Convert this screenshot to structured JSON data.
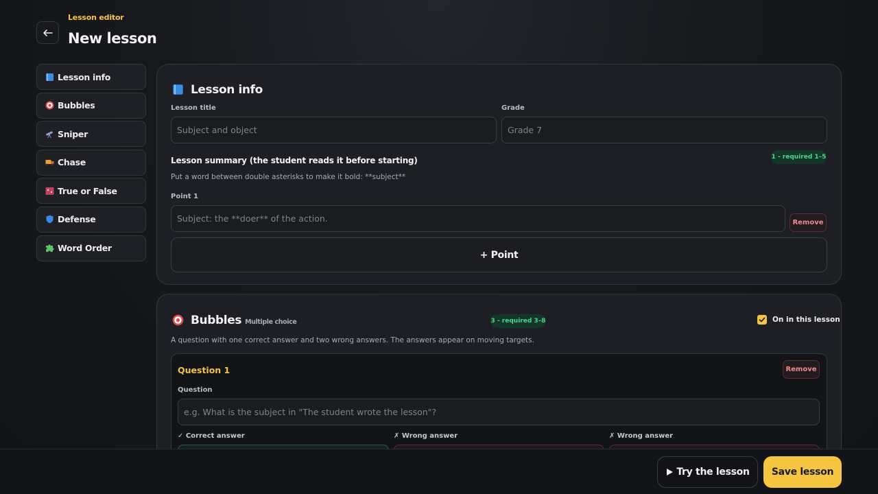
{
  "header": {
    "kicker": "Lesson editor",
    "title": "New lesson"
  },
  "sidebar": {
    "items": [
      {
        "label": "Lesson info",
        "icon": "book-icon"
      },
      {
        "label": "Bubbles",
        "icon": "target-icon"
      },
      {
        "label": "Sniper",
        "icon": "telescope-icon"
      },
      {
        "label": "Chase",
        "icon": "truck-icon"
      },
      {
        "label": "True or False",
        "icon": "traffic-light-icon"
      },
      {
        "label": "Defense",
        "icon": "shield-icon"
      },
      {
        "label": "Word Order",
        "icon": "puzzle-icon"
      }
    ]
  },
  "lesson_info": {
    "title": "Lesson info",
    "title_label": "Lesson title",
    "title_placeholder": "Subject and object",
    "grade_label": "Grade",
    "grade_placeholder": "Grade 7",
    "summary_title": "Lesson summary (the student reads it before starting)",
    "summary_badge": "1 - required 1–5",
    "summary_hint": "Put a word between double asterisks to make it bold: **subject**",
    "point_label": "Point 1",
    "point_placeholder": "Subject: the **doer** of the action.",
    "remove_label": "Remove",
    "add_point_label": "+ Point"
  },
  "bubbles": {
    "title": "Bubbles",
    "subtitle": "Multiple choice",
    "badge": "3 - required 3–8",
    "toggle_label": "On in this lesson",
    "toggle_checked": true,
    "description": "A question with one correct answer and two wrong answers. The answers appear on moving targets.",
    "question": {
      "title": "Question 1",
      "remove_label": "Remove",
      "question_label": "Question",
      "question_placeholder": "e.g. What is the subject in \"The student wrote the lesson\"?",
      "correct_label": "✓ Correct answer",
      "wrong_label_1": "✗ Wrong answer",
      "wrong_label_2": "✗ Wrong answer"
    }
  },
  "footer": {
    "try_label": "Try the lesson",
    "save_label": "Save lesson"
  },
  "colors": {
    "accent": "#f5c542",
    "success": "#4ad68c",
    "danger": "#ee8a8f"
  }
}
